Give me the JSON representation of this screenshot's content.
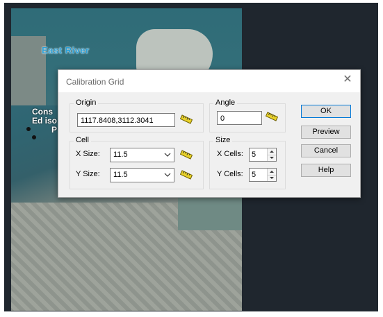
{
  "map": {
    "river_label": "East River",
    "place_label_lines": [
      "Cons",
      "Ed iso",
      "P"
    ]
  },
  "dialog": {
    "title": "Calibration Grid",
    "close_icon": "close-icon",
    "origin": {
      "label": "Origin",
      "value": "1117.8408,3112.3041"
    },
    "angle": {
      "label": "Angle",
      "value": "0"
    },
    "cell": {
      "label": "Cell",
      "x_label": "X Size:",
      "x_value": "11.5",
      "y_label": "Y Size:",
      "y_value": "11.5"
    },
    "size": {
      "label": "Size",
      "x_label": "X Cells:",
      "x_value": "5",
      "y_label": "Y Cells:",
      "y_value": "5"
    },
    "buttons": {
      "ok": "OK",
      "preview": "Preview",
      "cancel": "Cancel",
      "help": "Help"
    }
  },
  "colors": {
    "accent": "#0078d7",
    "ruler": "#e8d12a"
  }
}
